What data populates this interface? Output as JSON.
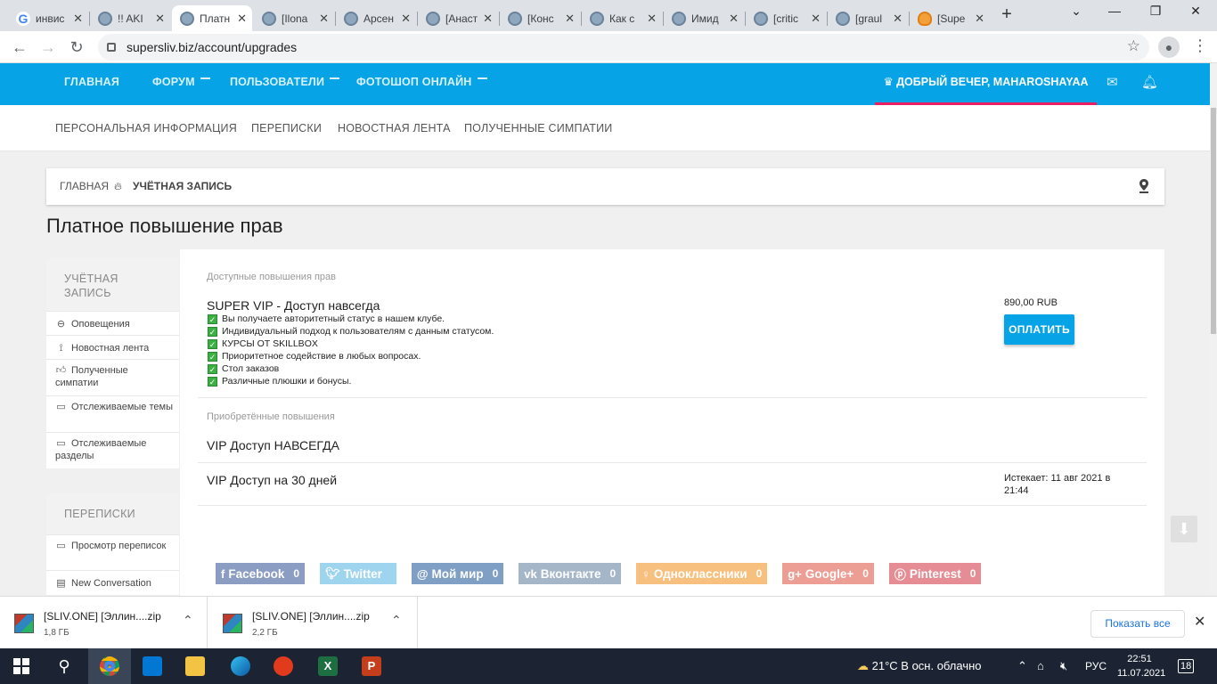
{
  "browser": {
    "tabs": [
      {
        "title": "инвис",
        "icon": "google-icon"
      },
      {
        "title": "!! AKI",
        "icon": "site-icon"
      },
      {
        "title": "Платн",
        "icon": "site-icon",
        "active": true
      },
      {
        "title": "[Ilona",
        "icon": "site-icon"
      },
      {
        "title": "Арсен",
        "icon": "site-icon"
      },
      {
        "title": "[Анаст",
        "icon": "site-icon"
      },
      {
        "title": "[Конс",
        "icon": "site-icon"
      },
      {
        "title": "Как с",
        "icon": "site-icon"
      },
      {
        "title": "Имид",
        "icon": "site-icon"
      },
      {
        "title": "[critic",
        "icon": "site-icon"
      },
      {
        "title": "[graul",
        "icon": "site-icon"
      },
      {
        "title": "[Supe",
        "icon": "cloud-icon"
      }
    ],
    "close_glyph": "✕",
    "new_tab_glyph": "+",
    "url": "supersliv.biz/account/upgrades"
  },
  "site_nav": {
    "items": [
      "ГЛАВНАЯ",
      "ФОРУМ",
      "ПОЛЬЗОВАТЕЛИ",
      "ФОТОШОП ОНЛАЙН"
    ],
    "greeting": "ДОБРЫЙ ВЕЧЕР, MAHAROSHAYAA",
    "accent_color": "#06a3e6",
    "underline_color": "#e91e63"
  },
  "sub_nav": [
    "ПЕРСОНАЛЬНАЯ ИНФОРМАЦИЯ",
    "ПЕРЕПИСКИ",
    "НОВОСТНАЯ ЛЕНТА",
    "ПОЛУЧЕННЫЕ СИМПАТИИ"
  ],
  "breadcrumb": {
    "home": "ГЛАВНАЯ",
    "current": "УЧЁТНАЯ ЗАПИСЬ"
  },
  "page_title": "Платное повышение прав",
  "sidebar": {
    "account": {
      "header": "УЧЁТНАЯ ЗАПИСЬ",
      "items": [
        "Оповещения",
        "Новостная лента",
        "Полученные симпатии",
        "Отслеживаемые темы",
        "Отслеживаемые разделы"
      ]
    },
    "conversations": {
      "header": "ПЕРЕПИСКИ",
      "items": [
        "Просмотр переписок",
        "New Conversation"
      ]
    }
  },
  "main": {
    "available_label": "Доступные повышения прав",
    "upgrade": {
      "name": "SUPER VIP - Доступ навсегда",
      "features": [
        "Вы получаете авторитетный статус в нашем клубе.",
        "Индивидуальный подход к пользователям с данным статусом.",
        "КУРСЫ ОТ SKILLBOX",
        "Приоритетное содействие в любых вопросах.",
        "Стол заказов",
        "Различные плюшки и бонусы."
      ],
      "price": "890,00 RUB",
      "pay_label": "ОПЛАТИТЬ"
    },
    "purchased_label": "Приобретённые повышения",
    "purchased": [
      {
        "name": "VIP Доступ НАВСЕГДА",
        "note": ""
      },
      {
        "name": "VIP Доступ на 30 дней",
        "note": "Истекает: 11 авг 2021 в 21:44"
      }
    ],
    "shares": [
      {
        "label": "Facebook",
        "count": "0",
        "color": "#8b9dc3",
        "icon": "facebook-icon"
      },
      {
        "label": "Twitter",
        "count": "",
        "color": "#9fd4ef",
        "icon": "twitter-icon"
      },
      {
        "label": "Мой мир",
        "count": "0",
        "color": "#7f9fc5",
        "icon": "mymir-icon"
      },
      {
        "label": "Вконтакте",
        "count": "0",
        "color": "#a5b6c9",
        "icon": "vk-icon"
      },
      {
        "label": "Одноклассники",
        "count": "0",
        "color": "#f7c07f",
        "icon": "ok-icon"
      },
      {
        "label": "Google+",
        "count": "0",
        "color": "#ec9d94",
        "icon": "googleplus-icon"
      },
      {
        "label": "Pinterest",
        "count": "0",
        "color": "#e58c94",
        "icon": "pinterest-icon"
      }
    ]
  },
  "downloads": {
    "items": [
      {
        "name": "[SLIV.ONE] [Эллин....zip",
        "size": "1,8 ГБ"
      },
      {
        "name": "[SLIV.ONE] [Эллин....zip",
        "size": "2,2 ГБ"
      }
    ],
    "show_all": "Показать все"
  },
  "taskbar": {
    "weather": "21°C  В осн. облачно",
    "lang": "РУС",
    "time": "22:51",
    "date": "11.07.2021",
    "notifications": "18"
  }
}
